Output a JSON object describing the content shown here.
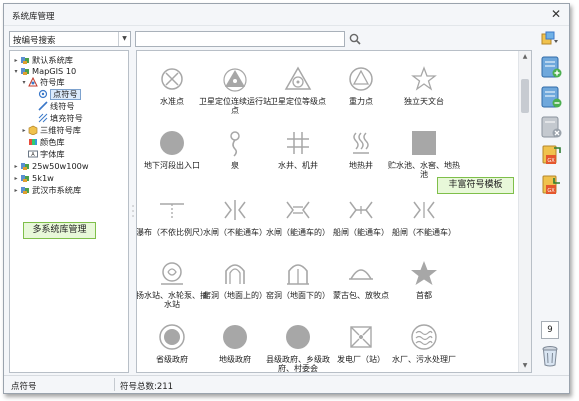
{
  "window": {
    "title": "系统库管理",
    "close_glyph": "✕"
  },
  "toolbar": {
    "search_mode": "按编号搜索",
    "search_value": ""
  },
  "tree": [
    {
      "label": "默认系统库",
      "expander": "▸"
    },
    {
      "label": "MapGIS 10",
      "expander": "▾"
    },
    {
      "label": "符号库",
      "expander": "▾"
    },
    {
      "label": "点符号",
      "expander": ""
    },
    {
      "label": "线符号",
      "expander": ""
    },
    {
      "label": "填充符号",
      "expander": ""
    },
    {
      "label": "三维符号库",
      "expander": "▸"
    },
    {
      "label": "颜色库",
      "expander": ""
    },
    {
      "label": "字体库",
      "expander": ""
    },
    {
      "label": "25w50w100w",
      "expander": "▸"
    },
    {
      "label": "5k1w",
      "expander": "▸"
    },
    {
      "label": "武汉市系统库",
      "expander": "▸"
    }
  ],
  "callouts": {
    "left": "多系统库管理",
    "right": "丰富符号模板"
  },
  "symbols": [
    {
      "label": "水准点",
      "icon": "circle-x-icon"
    },
    {
      "label": "卫星定位连续运行站点",
      "icon": "triangle-dot-icon"
    },
    {
      "label": "卫星定位等级点",
      "icon": "triangle-circle-icon"
    },
    {
      "label": "重力点",
      "icon": "circle-triangle-icon"
    },
    {
      "label": "独立天文台",
      "icon": "star-outline-icon"
    },
    {
      "label": "地下河段出入口",
      "icon": "filled-circle-icon"
    },
    {
      "label": "泉",
      "icon": "spring-icon"
    },
    {
      "label": "水井、机井",
      "icon": "well-hash-icon"
    },
    {
      "label": "地热井",
      "icon": "geothermal-icon"
    },
    {
      "label": "贮水池、水窖、地热池",
      "icon": "filled-square-icon"
    },
    {
      "label": "瀑布（不依比例尺）",
      "icon": "waterfall-icon"
    },
    {
      "label": "水闸（不能通车）",
      "icon": "sluice-icon"
    },
    {
      "label": "水闸（能通车的）",
      "icon": "sluice-vehicle-icon"
    },
    {
      "label": "船闸（能通车）",
      "icon": "ship-lock-vehicle-icon"
    },
    {
      "label": "船闸（不能通车）",
      "icon": "ship-lock-icon"
    },
    {
      "label": "扬水站、水轮泵、抽水站",
      "icon": "pump-station-icon"
    },
    {
      "label": "窑洞（地面上的）",
      "icon": "cave-above-icon"
    },
    {
      "label": "窑洞（地面下的）",
      "icon": "cave-below-icon"
    },
    {
      "label": "蒙古包、放牧点",
      "icon": "yurt-icon"
    },
    {
      "label": "首都",
      "icon": "filled-star-icon"
    },
    {
      "label": "省级政府",
      "icon": "province-gov-icon"
    },
    {
      "label": "地级政府",
      "icon": "prefecture-gov-icon"
    },
    {
      "label": "县级政府、乡级政府、村委会",
      "icon": "county-gov-icon"
    },
    {
      "label": "发电厂（站）",
      "icon": "power-plant-icon"
    },
    {
      "label": "水厂、污水处理厂",
      "icon": "water-plant-icon"
    }
  ],
  "side_tools": [
    {
      "icon": "add-library-icon"
    },
    {
      "icon": "remove-library-icon"
    },
    {
      "icon": "delete-library-icon"
    },
    {
      "icon": "import-library-icon"
    },
    {
      "icon": "export-library-icon"
    }
  ],
  "side_count": "9",
  "status": {
    "current": "点符号",
    "total": "符号总数:211"
  },
  "colors": {
    "accent_blue": "#3a78c9",
    "callout_bg": "#e8f8d9",
    "callout_border": "#7fbf4a",
    "symbol_gray": "#a7a7a7"
  }
}
